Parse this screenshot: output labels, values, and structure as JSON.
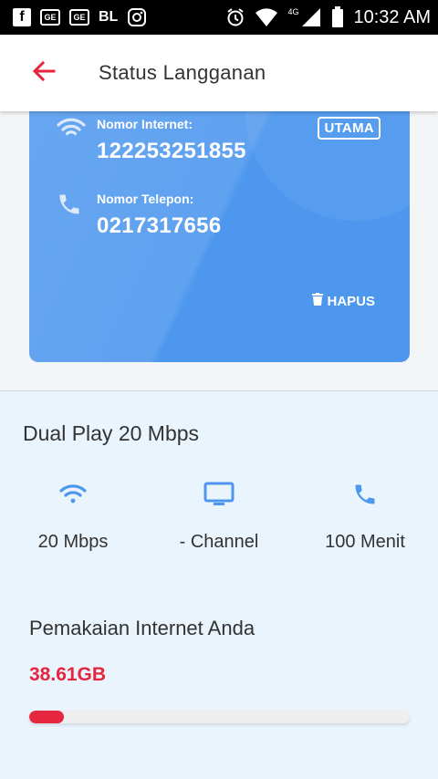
{
  "status_bar": {
    "icons_left": [
      "facebook-icon",
      "ge-icon",
      "ge-icon",
      "bl-text",
      "instagram-icon"
    ],
    "bl_text": "BL",
    "ge_text": "GE",
    "fb_text": "f",
    "network": "4G",
    "time": "10:32 AM"
  },
  "header": {
    "title": "Status Langganan",
    "back_icon": "arrow-left-icon",
    "accent_color": "#e5263f"
  },
  "card": {
    "internet_label": "Nomor Internet:",
    "internet_number": "122253251855",
    "phone_label": "Nomor Telepon:",
    "phone_number": "0217317656",
    "badge": "UTAMA",
    "delete_label": "HAPUS",
    "color": "#4d97ee"
  },
  "plan": {
    "name": "Dual Play 20 Mbps",
    "features": [
      {
        "icon": "wifi-icon",
        "label": "20 Mbps"
      },
      {
        "icon": "tv-icon",
        "label": "- Channel"
      },
      {
        "icon": "phone-icon",
        "label": "100 Menit"
      }
    ]
  },
  "usage": {
    "title": "Pemakaian Internet Anda",
    "value": "38.61GB",
    "progress_fraction": 0.09
  }
}
